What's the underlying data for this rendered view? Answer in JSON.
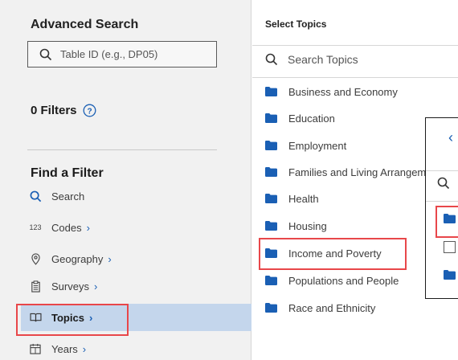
{
  "left_panel": {
    "title": "Advanced Search",
    "table_id_placeholder": "Table ID (e.g., DP05)",
    "filters_label": "0 Filters",
    "find_title": "Find a Filter",
    "nav": [
      {
        "label": "Search",
        "icon": "search-icon"
      },
      {
        "label": "Codes",
        "icon": "codes-icon",
        "badge": "123"
      },
      {
        "label": "Geography",
        "icon": "location-pin-icon"
      },
      {
        "label": "Surveys",
        "icon": "clipboard-icon"
      },
      {
        "label": "Topics",
        "icon": "book-icon"
      },
      {
        "label": "Years",
        "icon": "calendar-icon"
      }
    ]
  },
  "right_panel": {
    "title": "Select Topics",
    "search_placeholder": "Search Topics",
    "topics": [
      "Business and Economy",
      "Education",
      "Employment",
      "Families and Living Arrangements",
      "Health",
      "Housing",
      "Income and Poverty",
      "Populations and People",
      "Race and Ethnicity"
    ]
  },
  "colors": {
    "accent": "#1a5fb4",
    "highlight_box": "#e8474a",
    "selected_bg": "#c4d6ec",
    "panel_bg": "#f1f1f1"
  }
}
